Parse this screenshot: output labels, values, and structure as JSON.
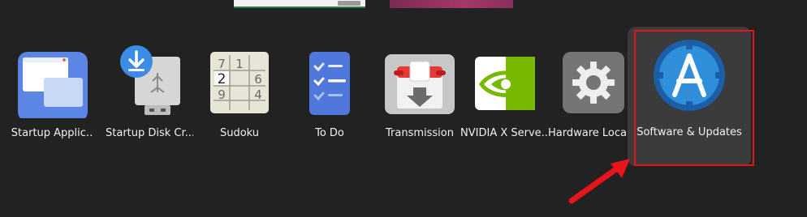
{
  "window_thumbnails": [
    {
      "name": "window-thumbnail-left"
    },
    {
      "name": "window-thumbnail-right"
    }
  ],
  "apps": [
    {
      "id": "startup-applications",
      "label": "Startup Applic..",
      "icon": "startup-applications-icon"
    },
    {
      "id": "startup-disk-creator",
      "label": "Startup Disk Cr...",
      "icon": "usb-download-icon"
    },
    {
      "id": "sudoku",
      "label": "Sudoku",
      "icon": "sudoku-grid-icon",
      "grid": [
        "7",
        "1",
        "",
        "",
        "",
        "",
        "2",
        "",
        "6",
        "9",
        "",
        "4"
      ]
    },
    {
      "id": "to-do",
      "label": "To Do",
      "icon": "checklist-icon"
    },
    {
      "id": "transmission",
      "label": "Transmission",
      "icon": "transmission-icon"
    },
    {
      "id": "nvidia-x-server",
      "label": "NVIDIA X Serve..",
      "icon": "nvidia-eye-icon"
    },
    {
      "id": "hardware-locale",
      "label": "Hardware Local...",
      "icon": "gear-icon"
    },
    {
      "id": "software-updates",
      "label": "Software & Updates",
      "icon": "software-updates-icon",
      "selected": true
    }
  ],
  "colors": {
    "background": "#222222",
    "highlight": "#e8141c",
    "selected_tile": "#3b3b3b"
  }
}
